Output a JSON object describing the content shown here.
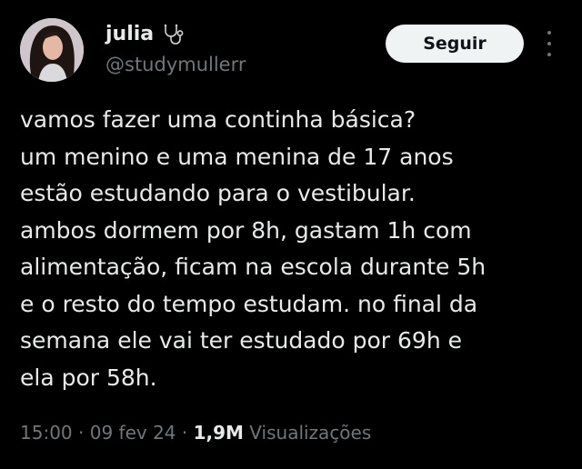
{
  "author": {
    "display_name": "julia",
    "handle": "@studymullerr",
    "badge_icon": "stethoscope-icon",
    "avatar": "profile-photo"
  },
  "actions": {
    "follow_label": "Seguir",
    "more_icon": "more-dots-icon"
  },
  "tweet": {
    "lines": [
      "vamos fazer uma continha básica?",
      "um menino e uma menina de 17 anos",
      "estão estudando para o vestibular.",
      "ambos dormem por 8h, gastam 1h com",
      "alimentação, ficam na escola durante 5h",
      "e o resto do tempo estudam. no final da",
      "semana ele vai ter estudado por 69h e",
      "ela por 58h."
    ]
  },
  "meta": {
    "time": "15:00",
    "separator": " · ",
    "date": "09 fev 24",
    "views_count": "1,9M",
    "views_label": " Visualizações"
  },
  "colors": {
    "background": "#000000",
    "text": "#e7e9ea",
    "secondary": "#71767b",
    "button_bg": "#eff3f4"
  }
}
